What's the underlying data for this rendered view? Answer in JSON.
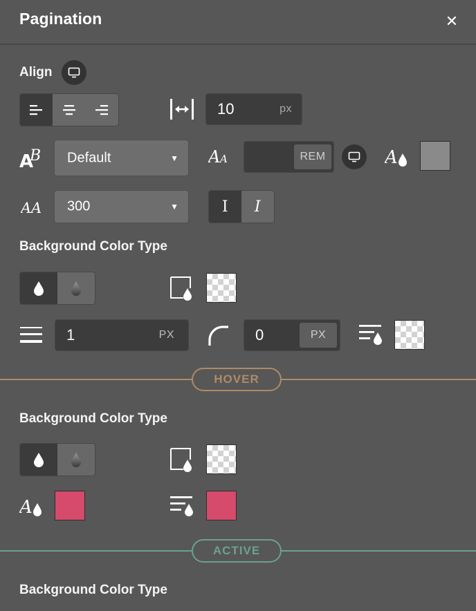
{
  "header": {
    "title": "Pagination",
    "close_icon": "close-icon"
  },
  "align": {
    "label": "Align",
    "device_icon": "monitor-icon",
    "options": [
      "align-left-icon",
      "align-center-icon",
      "align-right-icon"
    ],
    "selected": 0
  },
  "spacing": {
    "icon": "horizontal-spacing-icon",
    "value": "10",
    "unit": "px"
  },
  "font_family": {
    "icon": "font-family-icon",
    "value": "Default"
  },
  "font_size": {
    "icon": "font-size-icon",
    "value": "",
    "unit": "REM",
    "device_icon": "monitor-icon"
  },
  "text_color": {
    "icon": "text-color-icon",
    "color": "#8a8a8a"
  },
  "font_weight": {
    "icon": "font-weight-icon",
    "value": "300"
  },
  "font_style": {
    "normal": "I",
    "italic": "I",
    "selected": "normal"
  },
  "normal": {
    "bg_type_label": "Background Color Type",
    "bg_type_options": [
      "solid-drop-icon",
      "gradient-drop-icon"
    ],
    "bg_color_icon": "background-color-icon",
    "border_width": {
      "icon": "border-width-icon",
      "value": "1",
      "unit": "PX"
    },
    "border_radius": {
      "icon": "border-radius-icon",
      "value": "0",
      "unit": "PX"
    },
    "border_color_icon": "border-color-icon"
  },
  "hover": {
    "badge": "HOVER",
    "accent": "#b08a66",
    "bg_type_label": "Background Color Type",
    "text_color": "#d64a6c",
    "border_color": "#d64a6c"
  },
  "active": {
    "badge": "ACTIVE",
    "accent": "#6aa28d",
    "bg_type_label": "Background Color Type"
  }
}
